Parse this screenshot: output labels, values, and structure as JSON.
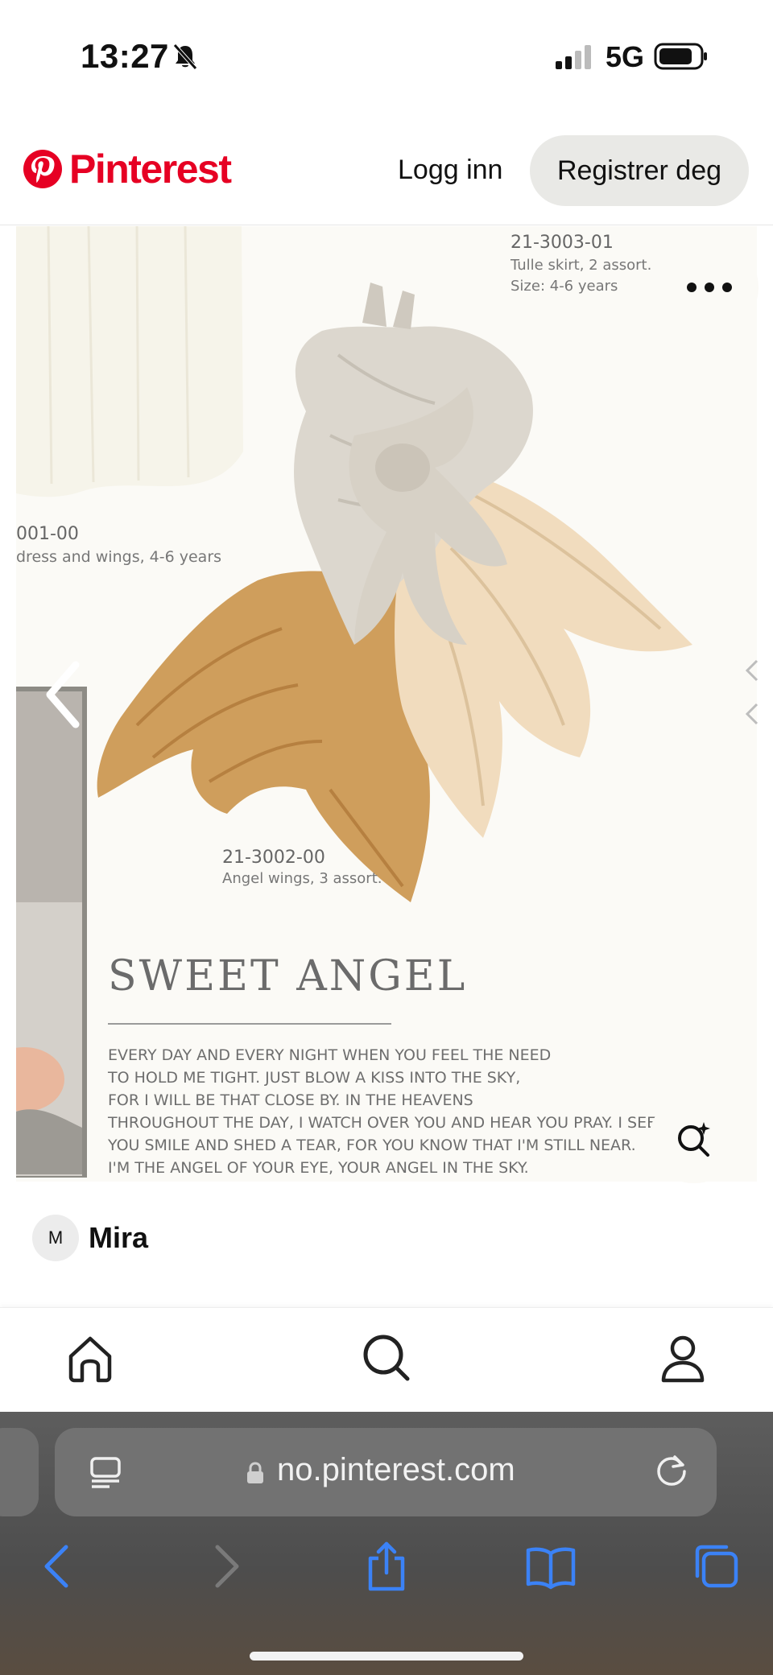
{
  "status_bar": {
    "time": "13:27",
    "network": "5G",
    "icons": [
      "bell-slash-icon",
      "signal-icon",
      "battery-icon"
    ]
  },
  "header": {
    "logo_text": "Pinterest",
    "login_label": "Logg inn",
    "register_label": "Registrer deg",
    "brand_color": "#e60023"
  },
  "pin": {
    "top_code": "21-3003-01",
    "top_desc_line1": "Tulle skirt, 2 assort.",
    "top_desc_line2": "Size: 4-6 years",
    "left_code": "001-00",
    "left_desc": "dress and wings, 4-6 years",
    "bottom_code": "21-3002-00",
    "bottom_desc": "Angel wings, 3 assort.",
    "title": "SWEET ANGEL",
    "poem_lines": [
      "EVERY DAY AND EVERY NIGHT WHEN YOU FEEL THE NEED",
      "TO HOLD ME TIGHT. JUST BLOW A KISS INTO THE SKY,",
      "FOR I WILL BE THAT CLOSE BY. IN THE HEAVENS",
      "THROUGHOUT THE DAY, I WATCH OVER YOU AND HEAR YOU PRAY. I SEE",
      "YOU SMILE AND SHED A TEAR, FOR YOU KNOW THAT I'M STILL NEAR.",
      "I'M THE ANGEL OF YOUR EYE, YOUR ANGEL IN THE SKY."
    ]
  },
  "author": {
    "initial": "M",
    "name": "Mira"
  },
  "bottom_nav": {
    "items": [
      "home-icon",
      "search-icon",
      "profile-icon"
    ]
  },
  "safari": {
    "url": "no.pinterest.com",
    "toolbar": [
      "back-icon",
      "forward-icon",
      "share-icon",
      "bookmarks-icon",
      "tabs-icon"
    ],
    "accent": "#3b82f6"
  }
}
